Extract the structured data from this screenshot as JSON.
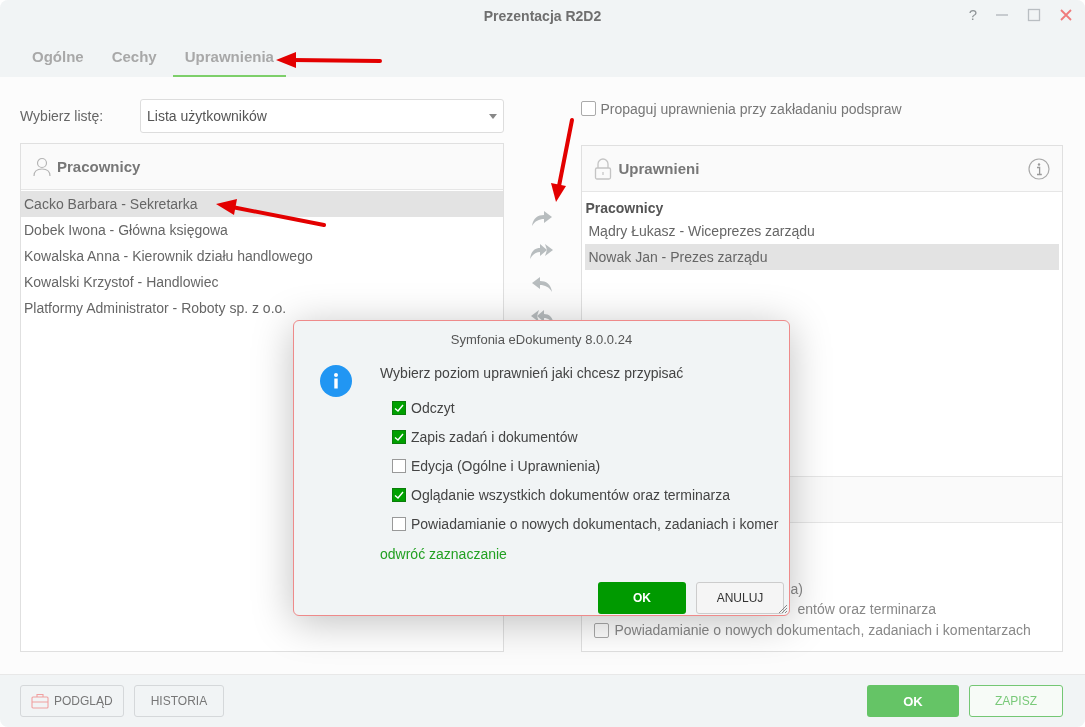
{
  "window": {
    "title": "Prezentacja R2D2",
    "help": "?"
  },
  "tabs": [
    {
      "label": "Ogólne",
      "selected": false
    },
    {
      "label": "Cechy",
      "selected": false
    },
    {
      "label": "Uprawnienia",
      "selected": true
    }
  ],
  "list_picker": {
    "label": "Wybierz listę:",
    "value": "Lista użytkowników"
  },
  "propagate": {
    "label": "Propaguj uprawnienia przy zakładaniu podspraw",
    "checked": false
  },
  "employees_panel": {
    "title": "Pracownicy",
    "items": [
      {
        "label": "Cacko Barbara - Sekretarka",
        "selected": true
      },
      {
        "label": "Dobek Iwona - Główna księgowa",
        "selected": false
      },
      {
        "label": "Kowalska Anna - Kierownik działu handlowego",
        "selected": false
      },
      {
        "label": "Kowalski Krzystof - Handlowiec",
        "selected": false
      },
      {
        "label": "Platformy Administrator - Roboty sp. z o.o.",
        "selected": false
      }
    ]
  },
  "authorized_panel": {
    "title": "Uprawnieni",
    "group": "Pracownicy",
    "items": [
      {
        "label": "Mądry Łukasz - Wiceprezes zarządu",
        "selected": false
      },
      {
        "label": "Nowak Jan - Prezes zarządu",
        "selected": true
      }
    ],
    "hidden_fragments": [
      "a)",
      "entów oraz terminarza"
    ],
    "permission": {
      "label": "Powiadamianie o nowych dokumentach, zadaniach i komentarzach",
      "checked": false
    }
  },
  "dialog": {
    "title": "Symfonia eDokumenty 8.0.0.24",
    "message": "Wybierz poziom uprawnień jaki chcesz przypisać",
    "options": [
      {
        "label": "Odczyt",
        "checked": true
      },
      {
        "label": "Zapis zadań i dokumentów",
        "checked": true
      },
      {
        "label": "Edycja (Ogólne i Uprawnienia)",
        "checked": false
      },
      {
        "label": "Oglądanie wszystkich dokumentów oraz terminarza",
        "checked": true
      },
      {
        "label": "Powiadamianie o nowych dokumentach, zadaniach i komer",
        "checked": false
      }
    ],
    "invert_link": "odwróć zaznaczanie",
    "ok": "OK",
    "cancel": "ANULUJ"
  },
  "footer": {
    "left": [
      "PODGLĄD",
      "HISTORIA"
    ],
    "ok": "OK",
    "save": "ZAPISZ"
  }
}
